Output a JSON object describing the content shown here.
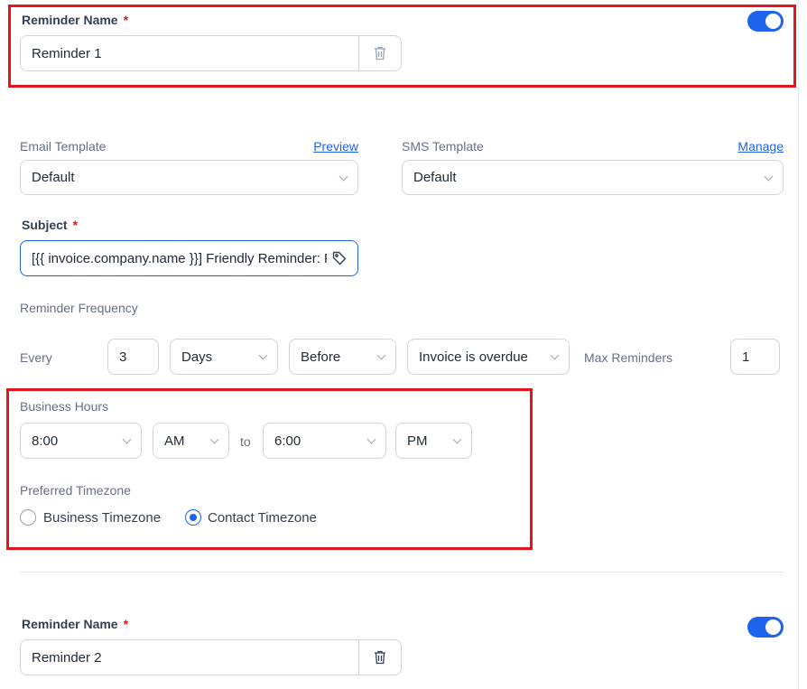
{
  "reminders": [
    {
      "name_label": "Reminder Name",
      "required_mark": "*",
      "name_value": "Reminder 1",
      "enabled": true
    },
    {
      "name_label": "Reminder Name",
      "required_mark": "*",
      "name_value": "Reminder 2",
      "enabled": true
    }
  ],
  "email_template": {
    "label": "Email Template",
    "link": "Preview",
    "value": "Default"
  },
  "sms_template": {
    "label": "SMS Template",
    "link": "Manage",
    "value": "Default"
  },
  "subject": {
    "label": "Subject",
    "required_mark": "*",
    "value": "[{{ invoice.company.name }}] Friendly Reminder: Pa"
  },
  "frequency": {
    "label": "Reminder Frequency",
    "every_label": "Every",
    "count": "3",
    "unit": "Days",
    "direction": "Before",
    "event": "Invoice is overdue",
    "max_label": "Max Reminders",
    "max_value": "1"
  },
  "business_hours": {
    "label": "Business Hours",
    "start_time": "8:00",
    "start_period": "AM",
    "to_label": "to",
    "end_time": "6:00",
    "end_period": "PM"
  },
  "timezone": {
    "label": "Preferred Timezone",
    "options": [
      "Business Timezone",
      "Contact Timezone"
    ],
    "selected": "Contact Timezone"
  },
  "colors": {
    "accent": "#1d63ed",
    "highlight": "#e5141b"
  }
}
